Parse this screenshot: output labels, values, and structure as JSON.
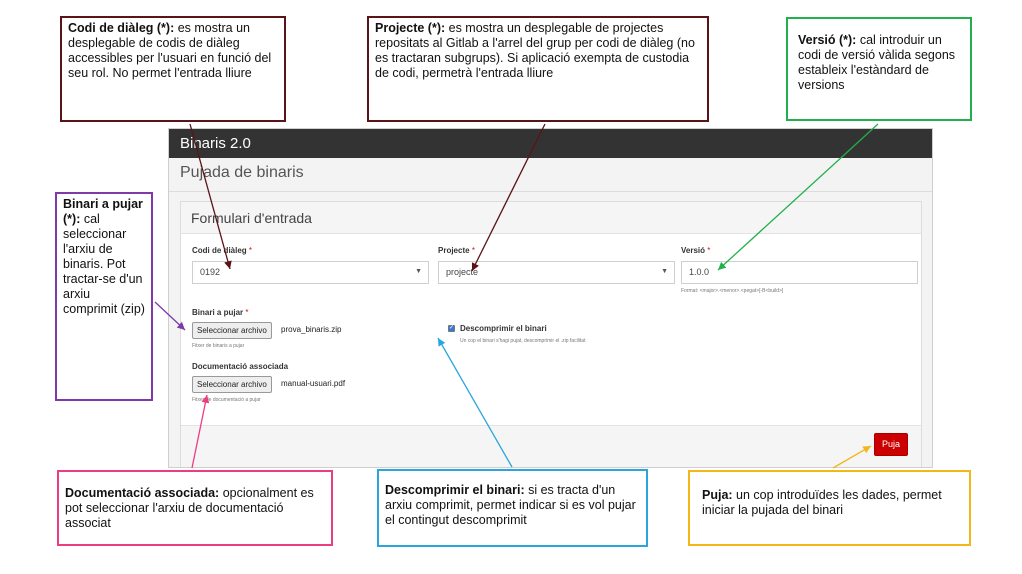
{
  "app": {
    "title": "Binaris 2.0",
    "page_title": "Pujada de binaris",
    "panel_title": "Formulari d'entrada",
    "required_mark": "*",
    "codi": {
      "label": "Codi de diàleg",
      "value": "0192"
    },
    "projecte": {
      "label": "Projecte",
      "value": "projecte"
    },
    "versio": {
      "label": "Versió",
      "value": "1.0.0",
      "help": "Format: <major>.<menor>.<pegat>[-B<build>]"
    },
    "binari": {
      "label": "Binari a pujar",
      "button": "Seleccionar archivo",
      "filename": "prova_binaris.zip",
      "help": "Fitxer de binaris a pujar"
    },
    "descomprimir": {
      "label": "Descomprimir el binari",
      "checked": true,
      "help": "Un cop el binari s'hagi pujat, descomprimir el .zip facilitat"
    },
    "documentacio": {
      "label": "Documentació associada",
      "button": "Seleccionar archivo",
      "filename": "manual-usuari.pdf",
      "help": "Fitxer de documentació a pujar"
    },
    "submit": "Puja"
  },
  "callouts": {
    "codi": {
      "title": "Codi de diàleg (*):",
      "text": " es mostra un desplegable de codis de diàleg accessibles per l'usuari en funció del seu rol. No permet l'entrada lliure",
      "color": "#5a1418"
    },
    "projecte": {
      "title": "Projecte (*):",
      "text": " es mostra un desplegable de projectes repositats al Gitlab a l'arrel del grup per codi de diàleg (no es tractaran subgrups). Si aplicació exempta de custodia de codi, permetrà l'entrada lliure",
      "color": "#5a1418"
    },
    "versio": {
      "title": "Versió (*):",
      "text": " cal introduir un codi de versió vàlida segons estableix l'estàndard de versions",
      "color": "#21b04b"
    },
    "binari": {
      "title": "Binari a pujar (*):",
      "text": " cal seleccionar l'arxiu de binaris. Pot tractar-se d'un arxiu comprimit (zip)",
      "color": "#7d3aa8"
    },
    "documentacio": {
      "title": "Documentació associada:",
      "text": " opcionalment es pot seleccionar l'arxiu de documentació associat",
      "color": "#ec3c82"
    },
    "descomprimir": {
      "title": "Descomprimir el binari:",
      "text": " si es tracta d'un arxiu comprimit, permet indicar si es vol pujar el contingut descomprimit",
      "color": "#2aa6dc"
    },
    "puja": {
      "title": "Puja:",
      "text": " un cop introduïdes les dades, permet iniciar la pujada del binari",
      "color": "#f2b81a"
    }
  }
}
